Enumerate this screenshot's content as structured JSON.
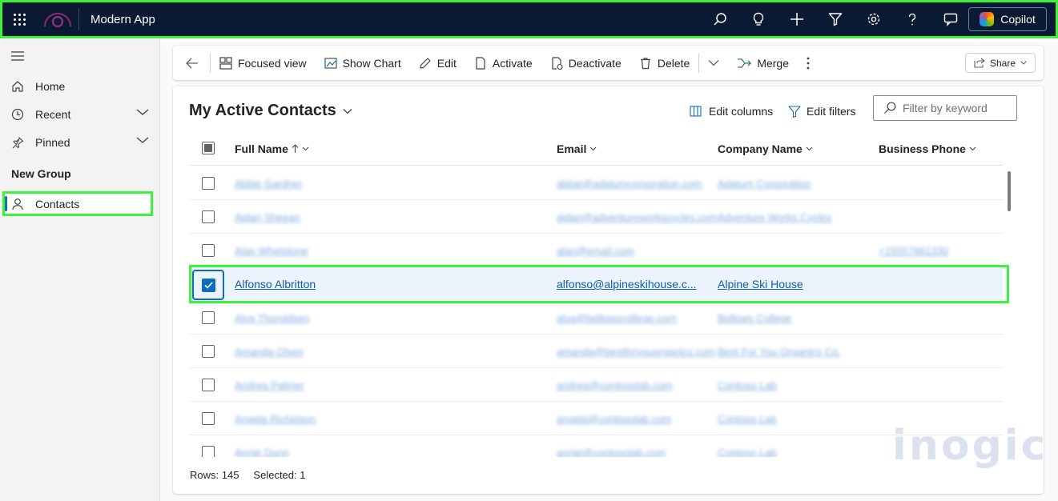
{
  "app": {
    "title": "Modern App",
    "copilot_label": "Copilot"
  },
  "topbar": {
    "icons": [
      "search-icon",
      "lightbulb-icon",
      "plus-icon",
      "filter-icon",
      "gear-icon",
      "help-icon",
      "chat-icon"
    ]
  },
  "sidebar": {
    "items": [
      {
        "label": "Home",
        "icon": "home-icon"
      },
      {
        "label": "Recent",
        "icon": "clock-icon"
      },
      {
        "label": "Pinned",
        "icon": "pin-icon"
      }
    ],
    "group_label": "New Group",
    "contacts_label": "Contacts"
  },
  "commands": {
    "focused_view": "Focused view",
    "show_chart": "Show Chart",
    "edit": "Edit",
    "activate": "Activate",
    "deactivate": "Deactivate",
    "delete": "Delete",
    "merge": "Merge",
    "share": "Share"
  },
  "view": {
    "title": "My Active Contacts",
    "edit_columns": "Edit columns",
    "edit_filters": "Edit filters",
    "filter_placeholder": "Filter by keyword"
  },
  "columns": {
    "full_name": "Full Name",
    "email": "Email",
    "company": "Company Name",
    "phone": "Business Phone"
  },
  "rows": [
    {
      "name": "Abbie Gardner",
      "email": "abbie@adatumcorporation.com",
      "company": "Adatum Corporation",
      "phone": "",
      "blurred": true,
      "selected": false
    },
    {
      "name": "Aidan Sheean",
      "email": "aidan@adventureworkscycles.com",
      "company": "Adventure Works Cycles",
      "phone": "",
      "blurred": true,
      "selected": false
    },
    {
      "name": "Alan Whetstone",
      "email": "alan@email.com",
      "company": "",
      "phone": "+15557861330",
      "blurred": true,
      "selected": false
    },
    {
      "name": "Alfonso Albritton",
      "email": "alfonso@alpineskihouse.c...",
      "company": "Alpine Ski House",
      "phone": "",
      "blurred": false,
      "selected": true
    },
    {
      "name": "Alva Thoroldsen",
      "email": "alva@bellowscollege.com",
      "company": "Bellows College",
      "phone": "",
      "blurred": true,
      "selected": false
    },
    {
      "name": "Amanda Olsen",
      "email": "amanda@bestforyouorganics.com",
      "company": "Best For You Organics Co.",
      "phone": "",
      "blurred": true,
      "selected": false
    },
    {
      "name": "Andrea Palmer",
      "email": "andrea@contosolab.com",
      "company": "Contoso Lab",
      "phone": "",
      "blurred": true,
      "selected": false
    },
    {
      "name": "Angela Richelson",
      "email": "angela@contosolab.com",
      "company": "Contoso Lab",
      "phone": "",
      "blurred": true,
      "selected": false
    },
    {
      "name": "Annie Dunn",
      "email": "annie@contosolab.com",
      "company": "Contoso Lab",
      "phone": "",
      "blurred": true,
      "selected": false
    }
  ],
  "footer": {
    "rows": "Rows: 145",
    "selected": "Selected: 1"
  },
  "watermark": "inogic"
}
